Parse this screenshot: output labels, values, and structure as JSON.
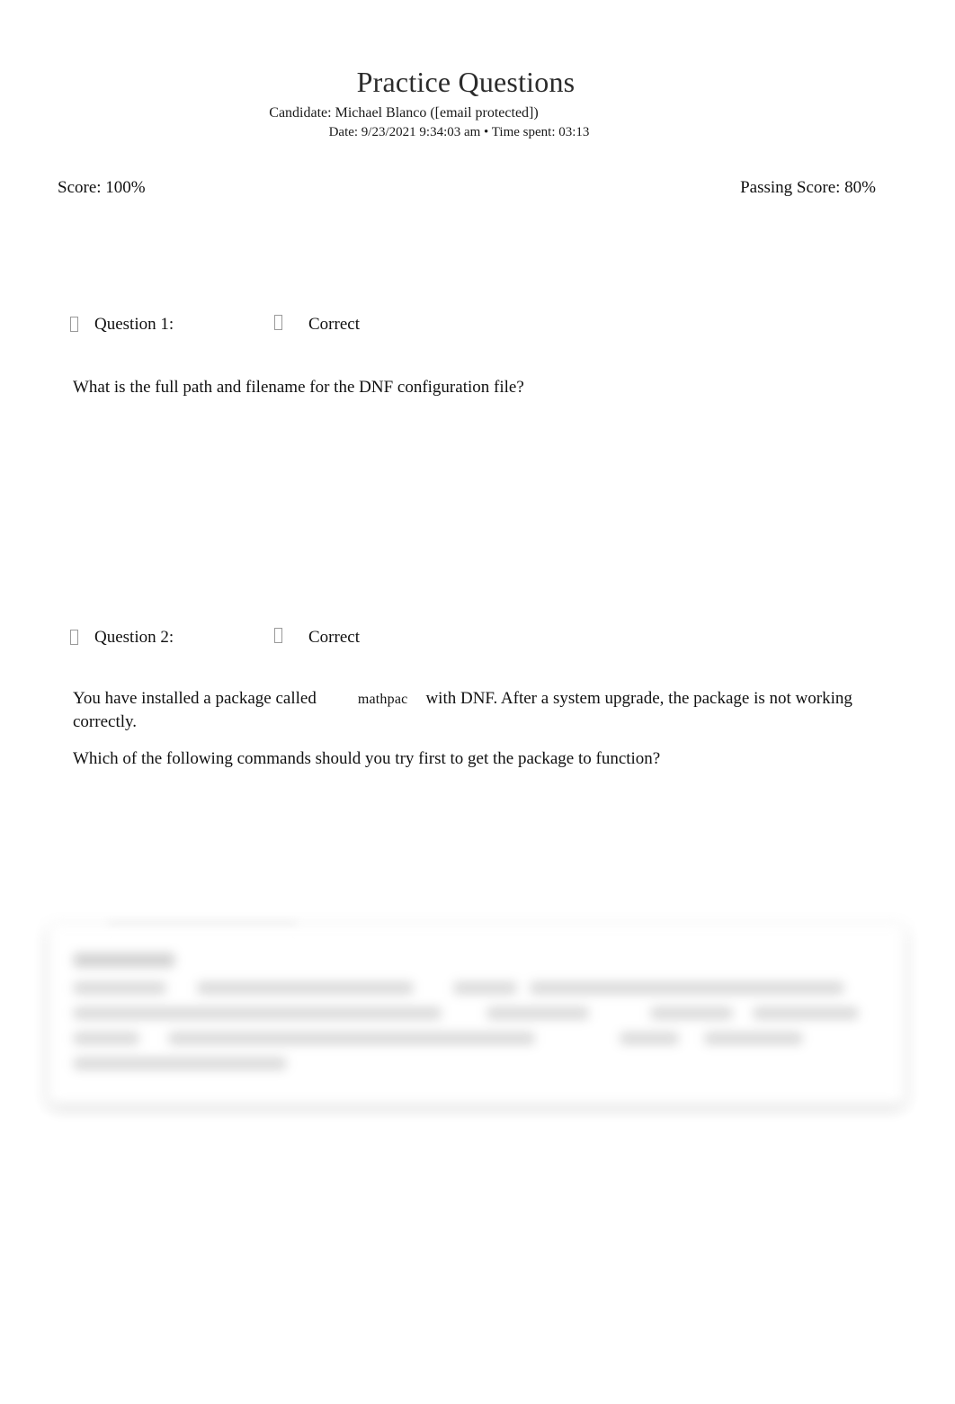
{
  "document": {
    "title": "Practice Questions",
    "candidate_line": "Candidate: Michael Blanco ([email protected])",
    "date_line": "Date: 9/23/2021 9:34:03 am • Time spent: 03:13"
  },
  "summary": {
    "score_label": "Score: 100%",
    "passing_score_label": "Passing Score: 80%"
  },
  "questions": [
    {
      "marker_glyph": "",
      "label": "Question 1:",
      "status_glyph": "",
      "status": "Correct",
      "text": "What is the full path and filename for the DNF configuration file?"
    },
    {
      "marker_glyph": "",
      "label": "Question 2:",
      "status_glyph": "",
      "status": "Correct",
      "text_before_code": "You have installed a package called",
      "code_term": "mathpac",
      "text_after_code": "with DNF. After a system upgrade, the package is not working correctly.",
      "second_paragraph": "Which of the following commands should you try first to get the package to function?"
    }
  ],
  "obscured_panel": {
    "note": "blurred explanation panel",
    "line_count": 4
  },
  "colors": {
    "page_background": "#ffffff",
    "body_text": "#111111",
    "title_text": "#2b2b2b",
    "marker_glyph": "#8c8c8c",
    "blur_line": "#cfcfcf"
  }
}
